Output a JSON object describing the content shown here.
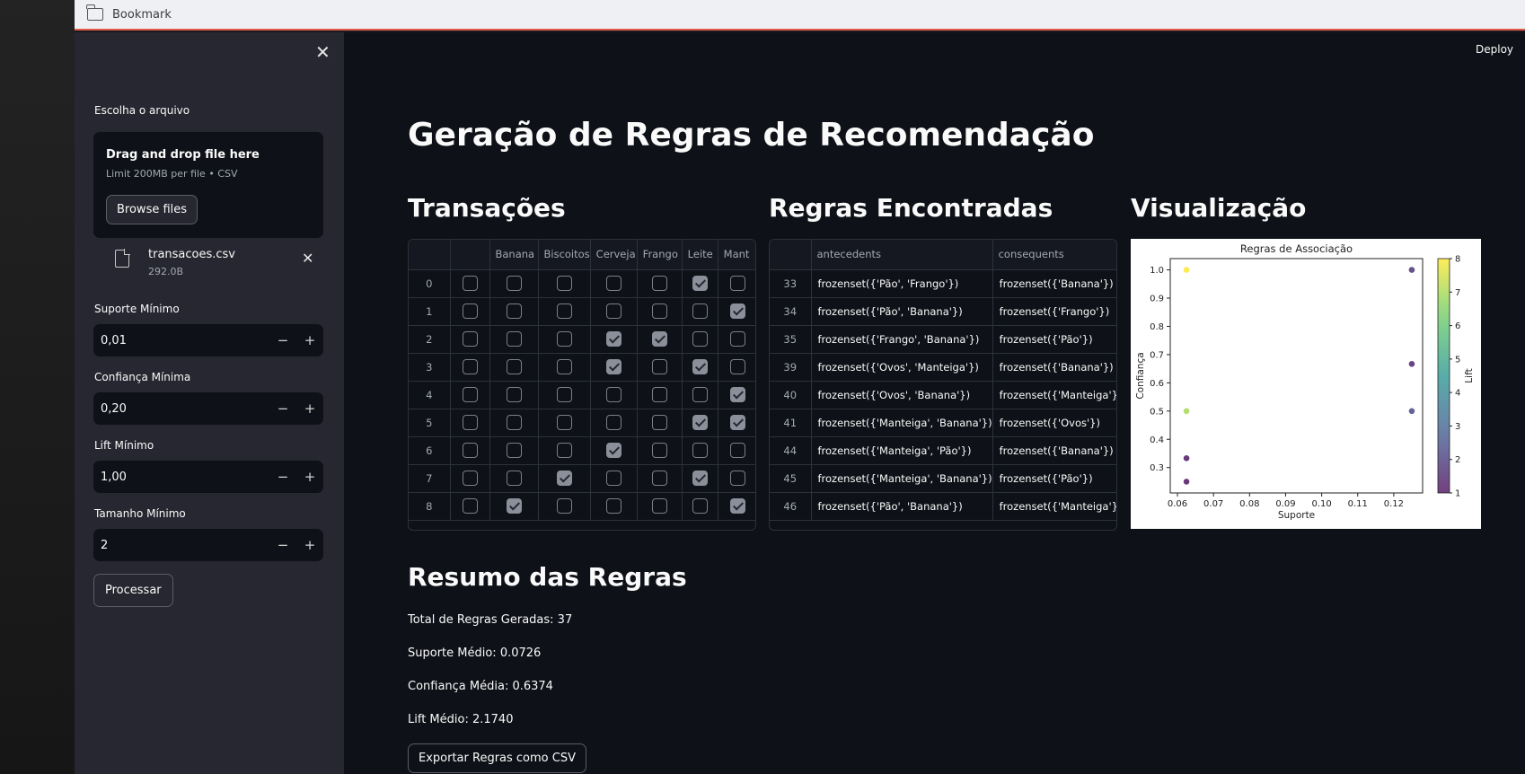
{
  "browser": {
    "bookmark_label": "Bookmark"
  },
  "sidebar": {
    "upload_label": "Escolha o arquivo",
    "drop_text": "Drag and drop file here",
    "limit_text": "Limit 200MB per file • CSV",
    "browse_label": "Browse files",
    "file_name": "transacoes.csv",
    "file_size": "292.0B",
    "fields": [
      {
        "label": "Suporte Mínimo",
        "value": "0,01"
      },
      {
        "label": "Confiança Mínima",
        "value": "0,20"
      },
      {
        "label": "Lift Mínimo",
        "value": "1,00"
      },
      {
        "label": "Tamanho Mínimo",
        "value": "2"
      }
    ],
    "minus": "−",
    "plus": "+",
    "process_label": "Processar",
    "close_glyph": "✕"
  },
  "header": {
    "deploy_label": "Deploy"
  },
  "main": {
    "title": "Geração de Regras de Recomendação",
    "transactions_heading": "Transações",
    "rules_heading": "Regras Encontradas",
    "viz_heading": "Visualização",
    "summary_heading": "Resumo das Regras",
    "summary": {
      "total": "Total de Regras Geradas: 37",
      "support": "Suporte Médio: 0.0726",
      "confidence": "Confiança Média: 0.6374",
      "lift": "Lift Médio: 2.1740"
    },
    "export_label": "Exportar Regras como CSV"
  },
  "transactions": {
    "columns": [
      "",
      "",
      "Banana",
      "Biscoitos",
      "Cerveja",
      "Frango",
      "Leite",
      "Mant"
    ],
    "rows": [
      {
        "idx": "0",
        "vals": [
          false,
          false,
          false,
          false,
          false,
          true,
          false
        ]
      },
      {
        "idx": "1",
        "vals": [
          false,
          false,
          false,
          false,
          false,
          false,
          true
        ]
      },
      {
        "idx": "2",
        "vals": [
          false,
          false,
          false,
          true,
          true,
          false,
          false
        ]
      },
      {
        "idx": "3",
        "vals": [
          false,
          false,
          false,
          true,
          false,
          true,
          false
        ]
      },
      {
        "idx": "4",
        "vals": [
          false,
          false,
          false,
          false,
          false,
          false,
          true
        ]
      },
      {
        "idx": "5",
        "vals": [
          false,
          false,
          false,
          false,
          false,
          true,
          true
        ]
      },
      {
        "idx": "6",
        "vals": [
          false,
          false,
          false,
          true,
          false,
          false,
          false
        ]
      },
      {
        "idx": "7",
        "vals": [
          false,
          false,
          true,
          false,
          false,
          true,
          false
        ]
      },
      {
        "idx": "8",
        "vals": [
          false,
          true,
          false,
          false,
          false,
          false,
          true
        ]
      }
    ]
  },
  "rules": {
    "columns": [
      "",
      "antecedents",
      "consequents"
    ],
    "rows": [
      [
        "33",
        "frozenset({'Pão', 'Frango'})",
        "frozenset({'Banana'})"
      ],
      [
        "34",
        "frozenset({'Pão', 'Banana'})",
        "frozenset({'Frango'})"
      ],
      [
        "35",
        "frozenset({'Frango', 'Banana'})",
        "frozenset({'Pão'})"
      ],
      [
        "39",
        "frozenset({'Ovos', 'Manteiga'})",
        "frozenset({'Banana'})"
      ],
      [
        "40",
        "frozenset({'Ovos', 'Banana'})",
        "frozenset({'Manteiga'})"
      ],
      [
        "41",
        "frozenset({'Manteiga', 'Banana'})",
        "frozenset({'Ovos'})"
      ],
      [
        "44",
        "frozenset({'Manteiga', 'Pão'})",
        "frozenset({'Banana'})"
      ],
      [
        "45",
        "frozenset({'Manteiga', 'Banana'})",
        "frozenset({'Pão'})"
      ],
      [
        "46",
        "frozenset({'Pão', 'Banana'})",
        "frozenset({'Manteiga'})"
      ]
    ]
  },
  "chart_data": {
    "type": "scatter",
    "title": "Regras de Associação",
    "xlabel": "Suporte",
    "ylabel": "Confiança",
    "colorbar_label": "Lift",
    "xlim": [
      0.058,
      0.128
    ],
    "ylim": [
      0.21,
      1.04
    ],
    "xticks": [
      "0.06",
      "0.07",
      "0.08",
      "0.09",
      "0.10",
      "0.11",
      "0.12"
    ],
    "xtick_values": [
      0.06,
      0.07,
      0.08,
      0.09,
      0.1,
      0.11,
      0.12
    ],
    "yticks": [
      "0.3",
      "0.4",
      "0.5",
      "0.6",
      "0.7",
      "0.8",
      "0.9",
      "1.0"
    ],
    "ytick_values": [
      0.3,
      0.4,
      0.5,
      0.6,
      0.7,
      0.8,
      0.9,
      1.0
    ],
    "colorbar_ticks": [
      "1",
      "2",
      "3",
      "4",
      "5",
      "6",
      "7",
      "8"
    ],
    "clim": [
      1,
      8
    ],
    "points": [
      {
        "x": 0.0625,
        "y": 1.0,
        "lift": 8.0
      },
      {
        "x": 0.0625,
        "y": 0.5,
        "lift": 7.0
      },
      {
        "x": 0.0625,
        "y": 0.333,
        "lift": 1.2
      },
      {
        "x": 0.0625,
        "y": 0.25,
        "lift": 1.1
      },
      {
        "x": 0.125,
        "y": 1.0,
        "lift": 1.8
      },
      {
        "x": 0.125,
        "y": 0.667,
        "lift": 1.5
      },
      {
        "x": 0.125,
        "y": 0.5,
        "lift": 2.3
      }
    ]
  }
}
